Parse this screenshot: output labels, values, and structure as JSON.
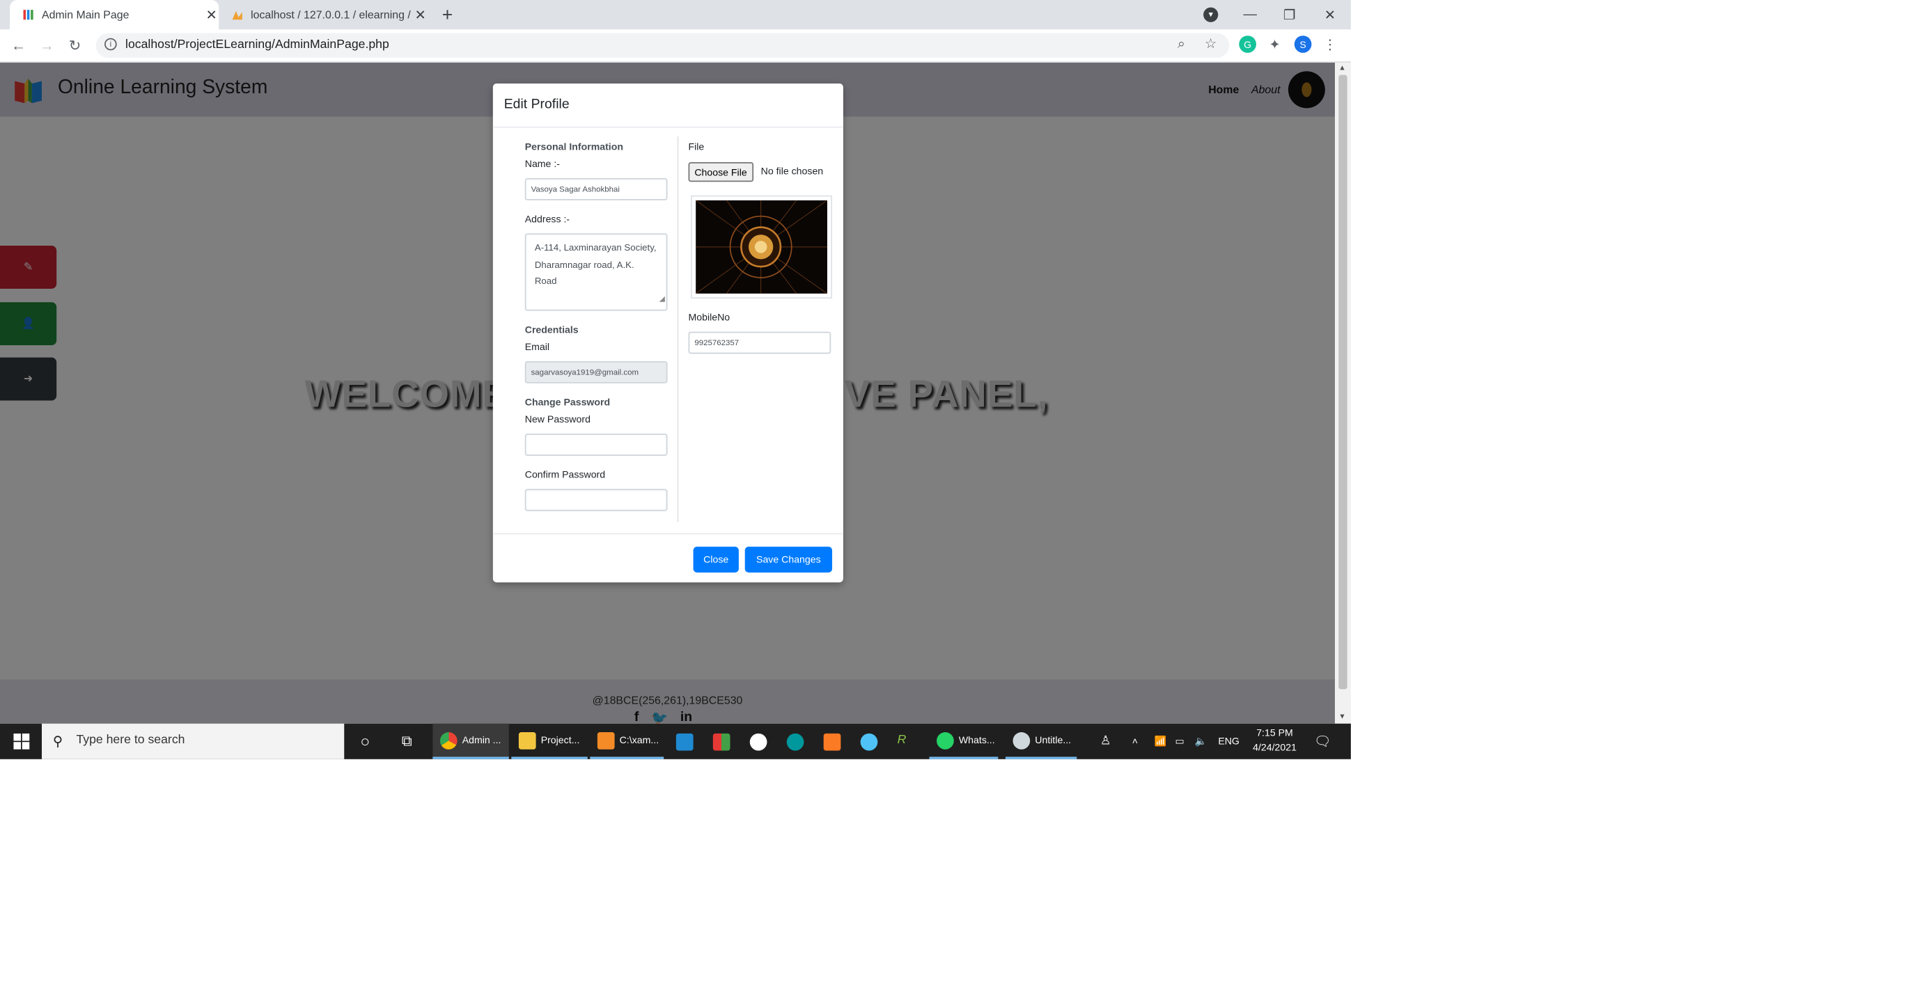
{
  "browser": {
    "tabs": [
      {
        "title": "Admin Main Page",
        "active": true
      },
      {
        "title": "localhost / 127.0.0.1 / elearning /",
        "active": false
      }
    ],
    "url": "localhost/ProjectELearning/AdminMainPage.php",
    "profile_initial": "S"
  },
  "site": {
    "brand": "Online Learning System",
    "nav": {
      "home": "Home",
      "about": "About"
    },
    "welcome_left": "WELCOME",
    "welcome_right": "VE PANEL,",
    "footer_copyright": "@18BCE(256,261),19BCE530",
    "side_buttons": [
      {
        "icon": "pencil-icon",
        "color": "#c82333"
      },
      {
        "icon": "user-icon",
        "color": "#218838"
      },
      {
        "icon": "sign-out-icon",
        "color": "#343a40"
      }
    ]
  },
  "modal": {
    "title": "Edit Profile",
    "personal_heading": "Personal Information",
    "name_label": "Name :-",
    "name_value": "Vasoya Sagar Ashokbhai",
    "address_label": "Address :-",
    "address_value": "A-114, Laxminarayan Society, Dharamnagar road, A.K. Road",
    "credentials_heading": "Credentials",
    "email_label": "Email",
    "email_value": "sagarvasoya1919@gmail.com",
    "change_password_heading": "Change Password",
    "new_password_label": "New Password",
    "confirm_password_label": "Confirm Password",
    "file_label": "File",
    "choose_file_label": "Choose File",
    "no_file_text": "No file chosen",
    "mobile_label": "MobileNo",
    "mobile_value": "9925762357",
    "close_label": "Close",
    "save_label": "Save Changes"
  },
  "taskbar": {
    "search_placeholder": "Type here to search",
    "apps": [
      {
        "label": "Admin ...",
        "icon": "chrome-icon"
      },
      {
        "label": "Project...",
        "icon": "folder-icon"
      },
      {
        "label": "C:\\xam...",
        "icon": "sublime-icon"
      },
      {
        "label": "",
        "icon": "vscode-icon"
      },
      {
        "label": "",
        "icon": "app-grid-icon"
      },
      {
        "label": "",
        "icon": "app-w-icon"
      },
      {
        "label": "",
        "icon": "arduino-icon"
      },
      {
        "label": "",
        "icon": "xampp-icon"
      },
      {
        "label": "",
        "icon": "app-circle-icon"
      },
      {
        "label": "",
        "icon": "app-r-icon"
      },
      {
        "label": "Whats...",
        "icon": "whatsapp-icon"
      },
      {
        "label": "Untitle...",
        "icon": "paint-icon"
      }
    ],
    "language": "ENG",
    "time": "7:15 PM",
    "date": "4/24/2021"
  },
  "colors": {
    "primary": "#007bff",
    "danger": "#c82333",
    "success": "#218838",
    "dark": "#343a40"
  }
}
